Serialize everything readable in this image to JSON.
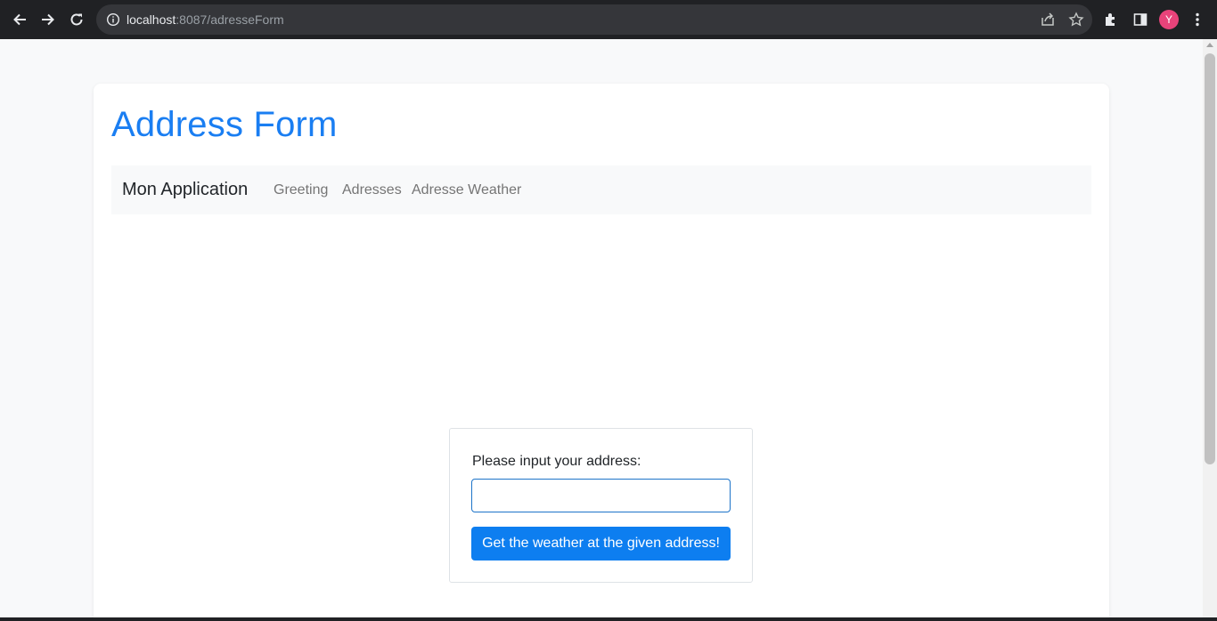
{
  "browser": {
    "url_host": "localhost",
    "url_path": ":8087/adresseForm",
    "profile_initial": "Y",
    "colors": {
      "chrome_bg": "#202124",
      "omnibox_bg": "#35363a",
      "avatar": "#e8437a"
    },
    "icons": [
      "back-arrow-icon",
      "forward-arrow-icon",
      "reload-icon",
      "info-icon",
      "share-icon",
      "bookmark-star-icon",
      "extensions-icon",
      "side-panel-icon",
      "kebab-menu-icon"
    ]
  },
  "page": {
    "title": "Address Form",
    "title_color": "#1a7ef2",
    "navbar": {
      "brand": "Mon Application",
      "links": [
        "Greeting",
        "Adresses",
        "Adresse Weather"
      ]
    },
    "form": {
      "label": "Please input your address:",
      "input_value": "",
      "submit_label": "Get the weather at the given address!",
      "button_color": "#0d7ef0"
    }
  }
}
